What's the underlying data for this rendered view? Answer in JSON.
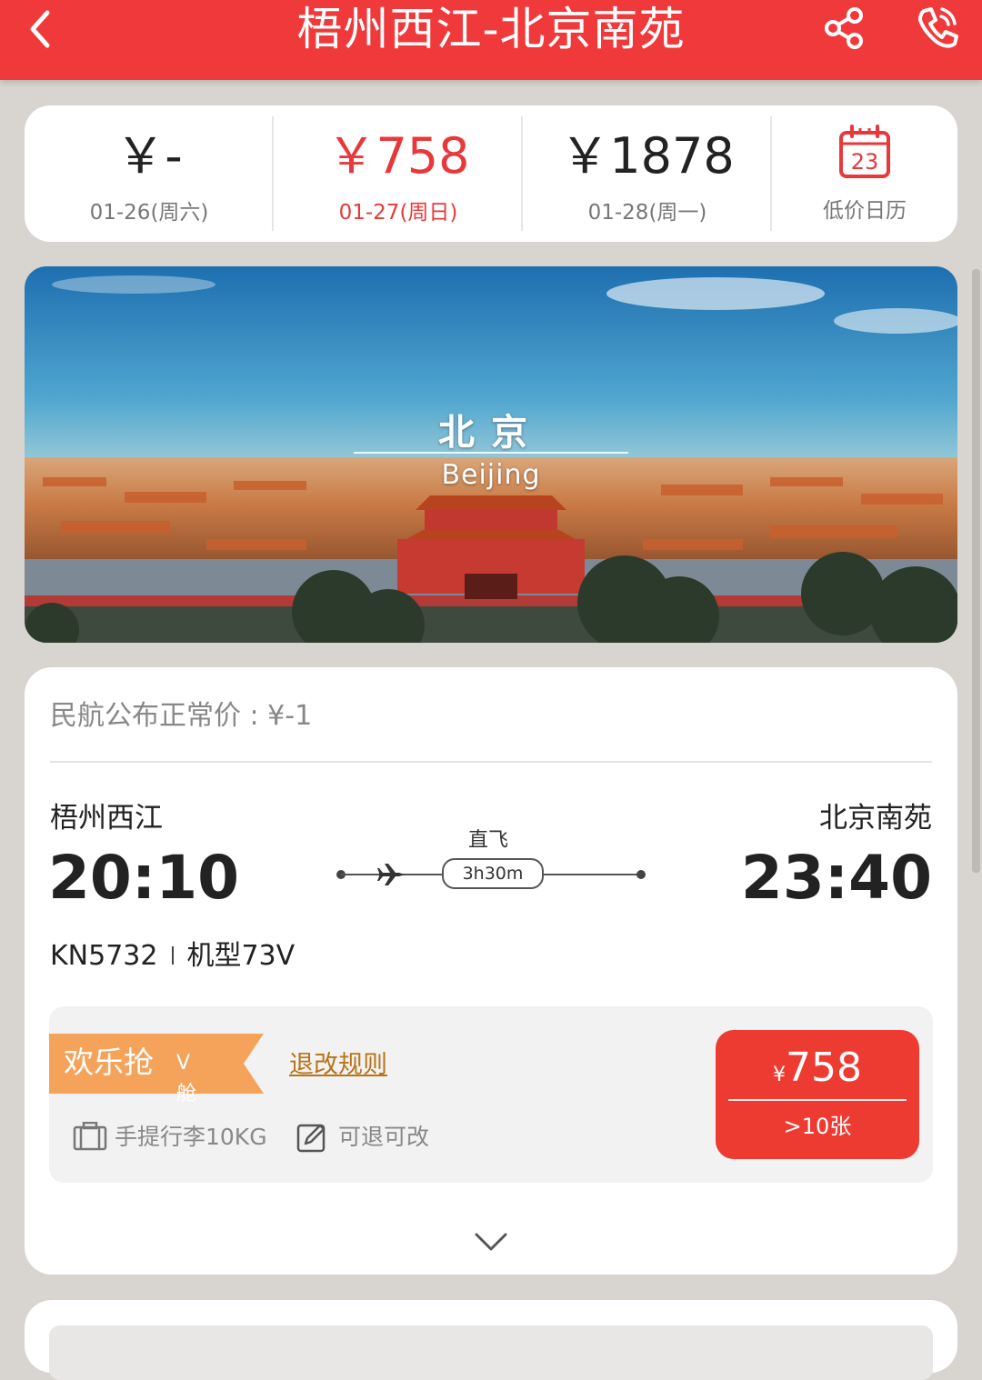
{
  "header": {
    "title": "梧州西江-北京南苑",
    "icons": [
      "chevron-left-icon",
      "share-icon",
      "phone-icon"
    ],
    "background": "#f0393b"
  },
  "dates": [
    {
      "price": "￥-",
      "date": "01-26(周六)",
      "active": false
    },
    {
      "price": "￥758",
      "date": "01-27(周日)",
      "active": true
    },
    {
      "price": "￥1878",
      "date": "01-28(周一)",
      "active": false
    }
  ],
  "calendar": {
    "day": "23",
    "label": "低价日历"
  },
  "banner": {
    "city_cn": "北京",
    "city_en": "Beijing"
  },
  "flight": {
    "official_price": "民航公布正常价 : ¥-1",
    "dep_city": "梧州西江",
    "arr_city": "北京南苑",
    "dep_time": "20:10",
    "arr_time": "23:40",
    "direct": "直飞",
    "duration": "3h30m",
    "flight_no": "KN5732",
    "aircraft": "机型73V"
  },
  "fare": {
    "tag": "欢乐抢",
    "cabin": "V舱",
    "rules_link": "退改规则",
    "baggage": "手提行李10KG",
    "refund": "可退可改",
    "currency": "¥",
    "price": "758",
    "remaining": ">10张",
    "tag_color": "#f5a35a",
    "button_color": "#ee3b32"
  }
}
